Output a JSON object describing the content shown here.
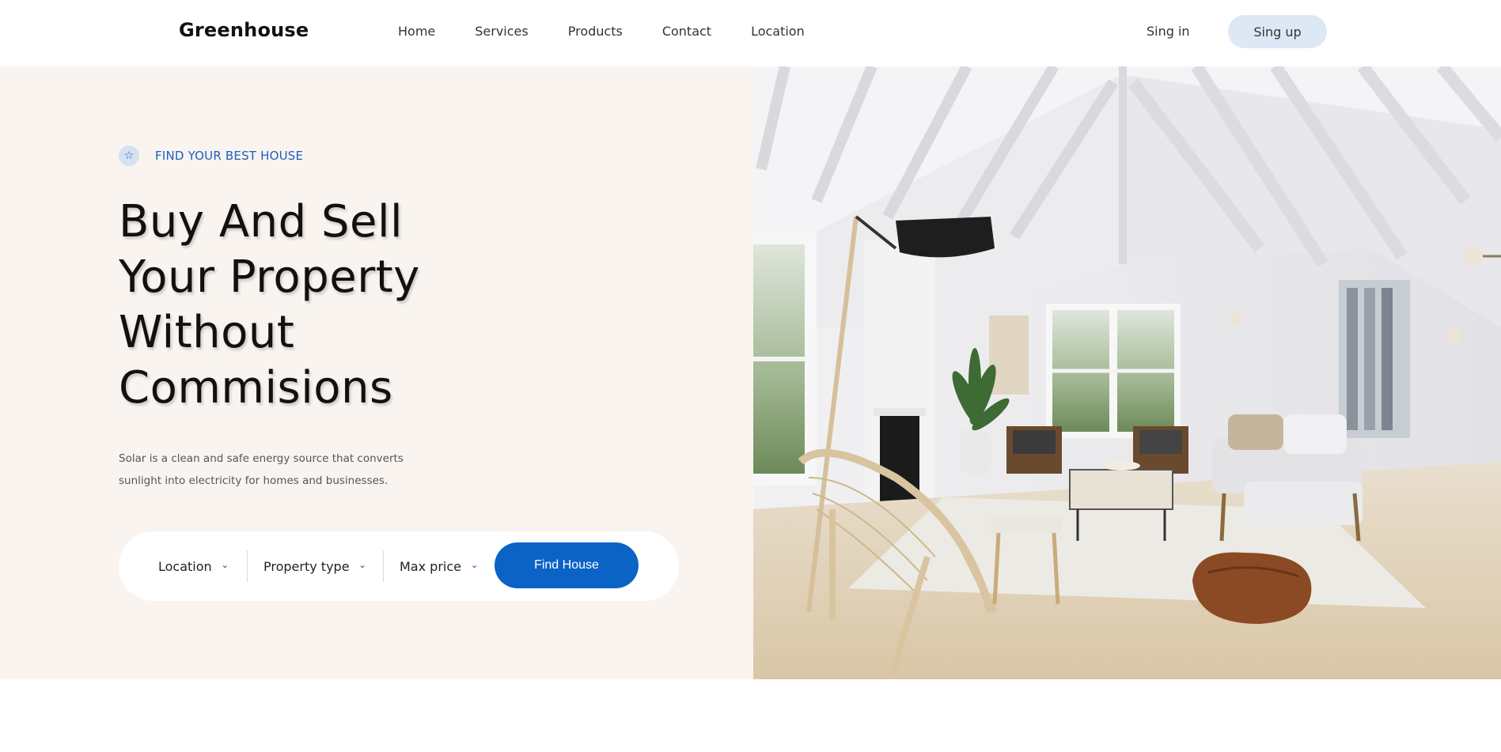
{
  "nav": {
    "logo": "Greenhouse",
    "links": [
      "Home",
      "Services",
      "Products",
      "Contact",
      "Location"
    ],
    "signin": "Sing in",
    "signup": "Sing up"
  },
  "hero": {
    "eyebrow": "FIND YOUR BEST HOUSE",
    "eyebrow_icon": "star-icon",
    "headline_lines": [
      "Buy And Sell",
      "Your Property",
      "Without",
      "Commisions"
    ],
    "description_lines": [
      "Solar is a clean and safe energy source that converts",
      "sunlight into electricity for homes and businesses."
    ],
    "search": {
      "location": "Location",
      "property_type": "Property type",
      "max_price": "Max price",
      "button": "Find House"
    }
  },
  "colors": {
    "accent": "#0b63c6",
    "hero_bg": "#f9f4f0",
    "signup_bg": "#dde8f6"
  }
}
